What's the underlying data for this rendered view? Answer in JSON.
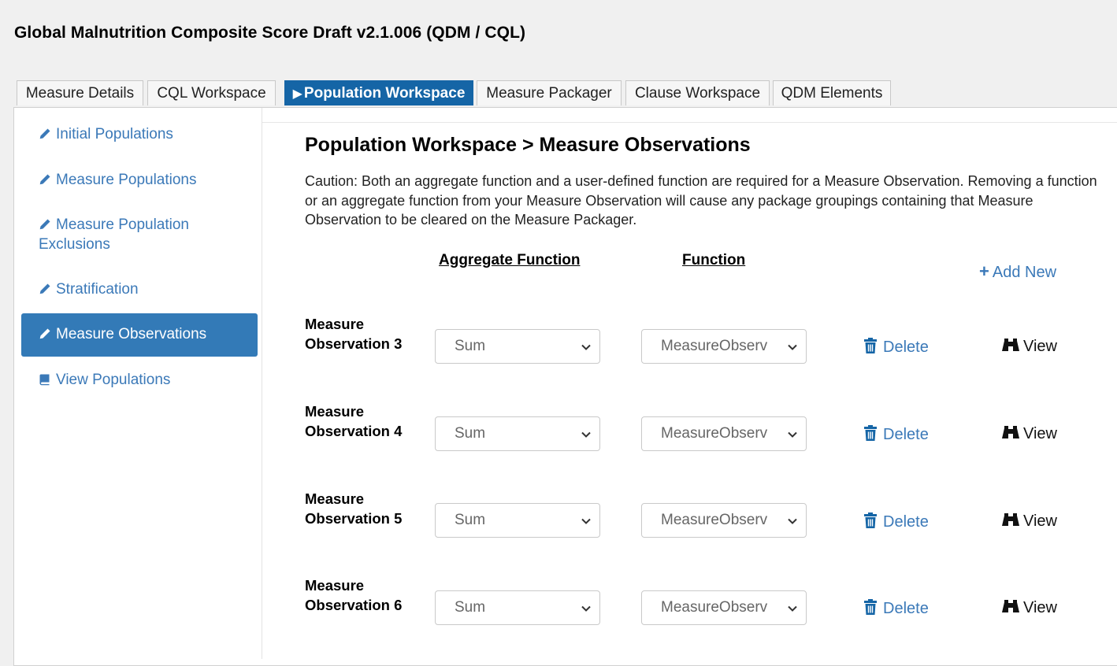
{
  "app_title": "Global Malnutrition Composite Score Draft v2.1.006 (QDM / CQL)",
  "tabs": [
    {
      "label": "Measure Details"
    },
    {
      "label": "CQL Workspace"
    },
    {
      "label": "Population Workspace",
      "active": true
    },
    {
      "label": "Measure Packager"
    },
    {
      "label": "Clause Workspace"
    },
    {
      "label": "QDM Elements"
    }
  ],
  "sidebar": {
    "items": [
      {
        "label": "Initial Populations",
        "icon": "pencil-icon"
      },
      {
        "label": "Measure Populations",
        "icon": "pencil-icon"
      },
      {
        "label": "Measure Population Exclusions",
        "icon": "pencil-icon"
      },
      {
        "label": "Stratification",
        "icon": "pencil-icon"
      },
      {
        "label": "Measure Observations",
        "icon": "pencil-icon",
        "active": true
      },
      {
        "label": "View Populations",
        "icon": "book-icon"
      }
    ]
  },
  "main": {
    "title": "Population Workspace > Measure Observations",
    "caution": "Caution: Both an aggregate function and a user-defined function are required for a Measure Observation. Removing a function or an aggregate function from your Measure Observation will cause any package groupings containing that Measure Observation to be cleared on the Measure Packager.",
    "headers": {
      "aggregate": "Aggregate Function",
      "function": "Function"
    },
    "add_new_label": "Add New",
    "delete_label": "Delete",
    "view_label": "View",
    "observations": [
      {
        "label": "Measure Observation 3",
        "aggregate": "Sum",
        "function": "MeasureObserv"
      },
      {
        "label": "Measure Observation 4",
        "aggregate": "Sum",
        "function": "MeasureObserv"
      },
      {
        "label": "Measure Observation 5",
        "aggregate": "Sum",
        "function": "MeasureObserv"
      },
      {
        "label": "Measure Observation 6",
        "aggregate": "Sum",
        "function": "MeasureObserv"
      }
    ]
  },
  "colors": {
    "accent": "#337ab7",
    "tab_active": "#1565a6",
    "link": "#3b79b8"
  }
}
